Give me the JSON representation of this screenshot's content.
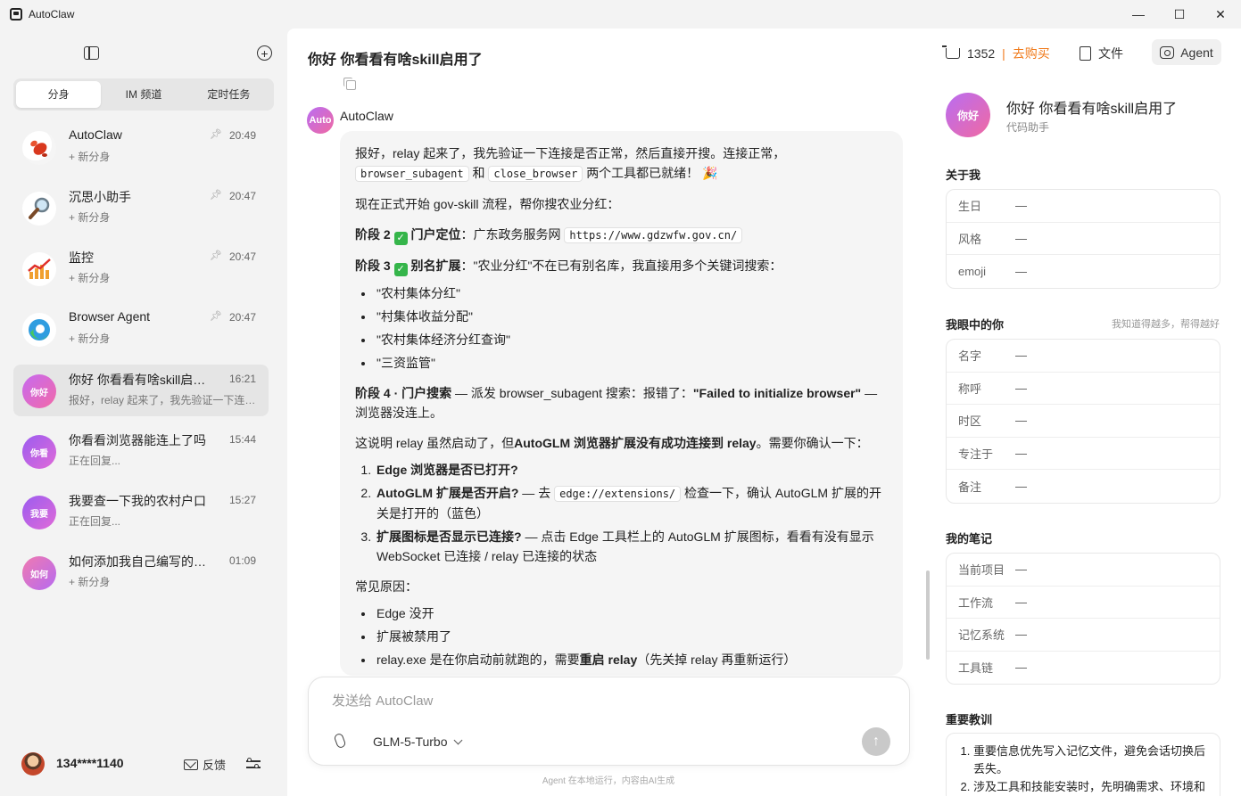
{
  "window": {
    "title": "AutoClaw",
    "minimize": "—",
    "maximize": "☐",
    "close": "✕"
  },
  "sidebar": {
    "tabs": [
      "分身",
      "IM 频道",
      "定时任务"
    ],
    "conversations": [
      {
        "title": "AutoClaw",
        "sub": "+ 新分身",
        "time": "20:49",
        "pinned": true,
        "avatar_icon": "lobster-icon"
      },
      {
        "title": "沉思小助手",
        "sub": "+ 新分身",
        "time": "20:47",
        "pinned": true,
        "avatar_icon": "magnifier-icon"
      },
      {
        "title": "监控",
        "sub": "+ 新分身",
        "time": "20:47",
        "pinned": true,
        "avatar_icon": "chart-icon"
      },
      {
        "title": "Browser Agent",
        "sub": "+ 新分身",
        "time": "20:47",
        "pinned": true,
        "avatar_icon": "browser-icon"
      },
      {
        "title": "你好 你看看有啥skill启用了",
        "sub": "报好，relay 起来了，我先验证一下连接是否正常",
        "time": "16:21",
        "avatar_text": "你好"
      },
      {
        "title": "你看看浏览器能连上了吗",
        "sub": "正在回复...",
        "time": "15:44",
        "avatar_text": "你看"
      },
      {
        "title": "我要查一下我的农村户口",
        "sub": "正在回复...",
        "time": "15:27",
        "avatar_text": "我要"
      },
      {
        "title": "如何添加我自己编写的skill",
        "sub": "+ 新分身",
        "time": "01:09",
        "avatar_text": "如何"
      }
    ],
    "user": {
      "name": "134****1140"
    },
    "feedback_label": "反馈"
  },
  "chat": {
    "title": "你好 你看看有啥skill启用了",
    "bot_avatar": "Auto",
    "bot_name": "AutoClaw",
    "message": {
      "p1_a": "报好，relay 起来了，我先验证一下连接是否正常，然后直接开搜。连接正常，",
      "code1": "browser_subagent",
      "p1_and": "和",
      "code2": "close_browser",
      "p1_b": "两个工具都已就绪！ 🎉",
      "p2": "现在正式开始 gov-skill 流程，帮你搜农业分红：",
      "s2_label": "阶段 2",
      "s2_title": "门户定位",
      "s2_text": "：广东政务服务网",
      "s2_code": "https://www.gdzwfw.gov.cn/",
      "s3_label": "阶段 3",
      "s3_title": "别名扩展",
      "s3_text": "：\"农业分红\"不在已有别名库，我直接用多个关键词搜索：",
      "keywords": [
        "\"农村集体分红\"",
        "\"村集体收益分配\"",
        "\"农村集体经济分红查询\"",
        "\"三资监管\""
      ],
      "s4_label": "阶段 4 · 门户搜索",
      "s4_text": " — 派发 browser_subagent 搜索：报错了：",
      "s4_err": "\"Failed to initialize browser\"",
      "s4_tail": "— 浏览器没连上。",
      "p5_a": "这说明 relay 虽然启动了，但",
      "p5_b": "AutoGLM 浏览器扩展没有成功连接到 relay",
      "p5_c": "。需要你确认一下：",
      "q1": "Edge 浏览器是否已打开?",
      "q2": "AutoGLM 扩展是否开启?",
      "q2_a": " — 去",
      "q2_code": "edge://extensions/",
      "q2_b": "检查一下，确认 AutoGLM 扩展的开关是打开的（蓝色）",
      "q3": "扩展图标是否显示已连接?",
      "q3_b": " — 点击 Edge 工具栏上的 AutoGLM 扩展图标，看看有没有显示 WebSocket 已连接 / relay 已连接的状态",
      "p6": "常见原因：",
      "reasons": [
        "Edge 没开",
        "扩展被禁用了"
      ],
      "r3_a": "relay.exe 是在你启动前就跑的，需要",
      "r3_b": "重启 relay",
      "r3_c": "（先关掉 relay 再重新运行）"
    },
    "input_placeholder": "发送给 AutoClaw",
    "model": "GLM-5-Turbo",
    "footnote": "Agent 在本地运行，内容由AI生成"
  },
  "right": {
    "cart_count": "1352",
    "cart_sep": "|",
    "buy": "去购买",
    "files": "文件",
    "agent": "Agent",
    "profile": {
      "avatar": "你好",
      "name": "你好 你看看有啥skill启用了",
      "role": "代码助手"
    },
    "about_title": "关于我",
    "about": [
      {
        "k": "生日",
        "v": "—"
      },
      {
        "k": "风格",
        "v": "—"
      },
      {
        "k": "emoji",
        "v": "—"
      }
    ],
    "view_title": "我眼中的你",
    "view_hint": "我知道得越多，帮得越好",
    "view": [
      {
        "k": "名字",
        "v": "—"
      },
      {
        "k": "称呼",
        "v": "—"
      },
      {
        "k": "时区",
        "v": "—"
      },
      {
        "k": "专注于",
        "v": "—"
      },
      {
        "k": "备注",
        "v": "—"
      }
    ],
    "notes_title": "我的笔记",
    "notes": [
      {
        "k": "当前项目",
        "v": "—"
      },
      {
        "k": "工作流",
        "v": "—"
      },
      {
        "k": "记忆系统",
        "v": "—"
      },
      {
        "k": "工具链",
        "v": "—"
      }
    ],
    "lessons_title": "重要教训",
    "lessons": [
      "重要信息优先写入记忆文件，避免会话切换后丢失。",
      "涉及工具和技能安装时，先明确需求、环境和"
    ]
  }
}
